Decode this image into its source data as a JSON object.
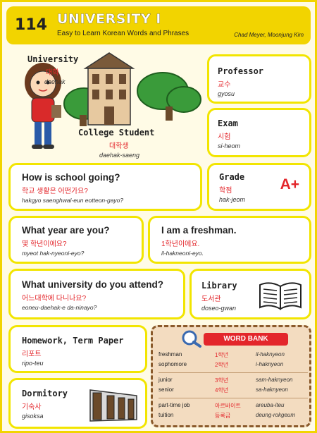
{
  "header": {
    "number": "114",
    "title": "UNIVERSITY I",
    "subtitle": "Easy to Learn Korean Words and Phrases",
    "authors": "Chad Meyer,  Moonjung Kim"
  },
  "scene": {
    "university": {
      "en": "University",
      "ko": "대학",
      "rom": "daehak"
    },
    "student": {
      "en": "College Student",
      "ko": "대학생",
      "rom": "daehak-saeng"
    }
  },
  "cards": {
    "professor": {
      "en": "Professor",
      "ko": "교수",
      "rom": "gyosu"
    },
    "exam": {
      "en": "Exam",
      "ko": "시험",
      "rom": "si-heom"
    },
    "school": {
      "en": "How is school going?",
      "ko": "학교 생활은 어떤가요?",
      "rom": "hakgyo saenghwal-eun eotteon-gayo?"
    },
    "grade": {
      "en": "Grade",
      "ko": "학점",
      "rom": "hak-jeom",
      "mark": "A+"
    },
    "year": {
      "en": "What year are you?",
      "ko": "몇 학년이에요?",
      "rom": "myeot hak-nyeoni-eyo?"
    },
    "freshman": {
      "en": "I am a freshman.",
      "ko": "1학년이에요.",
      "rom": "il-hakneoni-eyo."
    },
    "attend": {
      "en": "What university do you attend?",
      "ko": "어느대학에 다니나요?",
      "rom": "eoneu-daehak-e da-ninayo?"
    },
    "library": {
      "en": "Library",
      "ko": "도서관",
      "rom": "doseo-gwan"
    },
    "homework": {
      "en": "Homework, Term Paper",
      "ko": "리포트",
      "rom": "ripo-teu"
    },
    "dormitory": {
      "en": "Dormitory",
      "ko": "기숙사",
      "rom": "gisoksa"
    }
  },
  "word_bank": {
    "title": "WORD BANK",
    "rows": [
      {
        "en": "freshman",
        "ko": "1학년",
        "rom": "il-haknyeon"
      },
      {
        "en": "sophomore",
        "ko": "2학년",
        "rom": "i-haknyeon"
      },
      {
        "en": "junior",
        "ko": "3학년",
        "rom": "sam-haknyeon"
      },
      {
        "en": "senior",
        "ko": "4학년",
        "rom": "sa-haknyeon"
      },
      {
        "en": "part-time job",
        "ko": "아르바이트",
        "rom": "areuba-iteu"
      },
      {
        "en": "tuition",
        "ko": "등록금",
        "rom": "deung-rokgeum"
      }
    ]
  },
  "colors": {
    "border": "#f2e500",
    "header": "#f2d400",
    "korean": "#e3262b",
    "wordbank": "#f3dcc0"
  }
}
